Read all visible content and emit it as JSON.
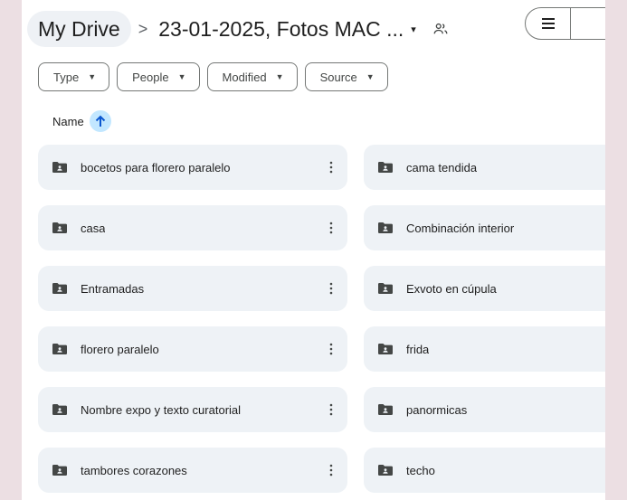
{
  "breadcrumb": {
    "root": "My Drive",
    "separator": ">",
    "current": "23-01-2025, Fotos MAC ...",
    "caret": "▾"
  },
  "filters": {
    "type": "Type",
    "people": "People",
    "modified": "Modified",
    "source": "Source"
  },
  "sort": {
    "label": "Name"
  },
  "folders": [
    {
      "name": "bocetos para florero paralelo"
    },
    {
      "name": "cama tendida"
    },
    {
      "name": "casa"
    },
    {
      "name": "Combinación interior"
    },
    {
      "name": "Entramadas"
    },
    {
      "name": "Exvoto en cúpula"
    },
    {
      "name": "florero paralelo"
    },
    {
      "name": "frida"
    },
    {
      "name": "Nombre expo y texto curatorial"
    },
    {
      "name": "panormicas"
    },
    {
      "name": "tambores corazones"
    },
    {
      "name": "techo"
    }
  ],
  "colors": {
    "accent": "#c2e7ff",
    "card": "#eef2f6",
    "icon": "#444746",
    "backdrop": "#ecdfe3"
  },
  "icons": {
    "folder": "shared-folder-icon",
    "sort": "arrow-up-icon",
    "share": "people-icon",
    "list_view": "list-view-icon",
    "grid_view": "checkmark-icon",
    "more": "more-vert-icon",
    "filter_caret": "caret-down-icon"
  }
}
